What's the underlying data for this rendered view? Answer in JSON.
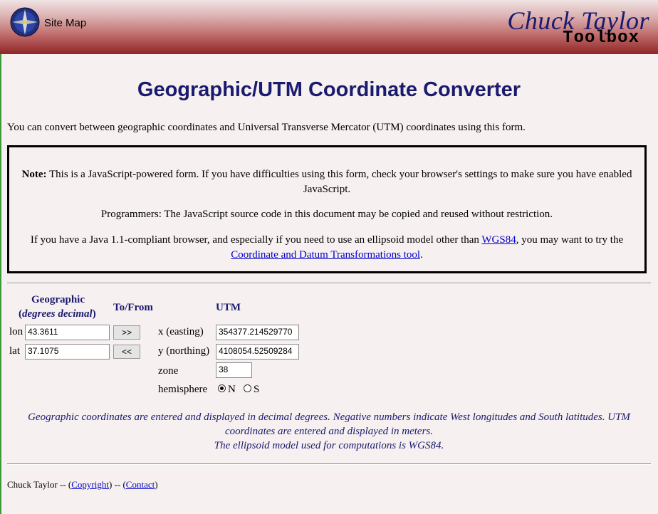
{
  "header": {
    "sitemap_label": "Site Map",
    "brand_line1": "Chuck Taylor",
    "brand_line2": "Toolbox"
  },
  "page_title": "Geographic/UTM Coordinate Converter",
  "intro": "You can convert between geographic coordinates and Universal Transverse Mercator (UTM) coordinates using this form.",
  "notice": {
    "note_label": "Note:",
    "note_text": "This is a JavaScript-powered form. If you have difficulties using this form, check your browser's settings to make sure you have enabled JavaScript.",
    "programmers": "Programmers: The JavaScript source code in this document may be copied and reused without restriction.",
    "java_pre": "If you have a Java 1.1-compliant browser, and especially if you need to use an ellipsoid model other than ",
    "wgs84": "WGS84",
    "java_mid": ", you may want to try the ",
    "tool_link": "Coordinate and Datum Transformations tool",
    "java_end": "."
  },
  "form": {
    "geographic_heading": "Geographic",
    "geographic_units": "degrees decimal",
    "tofrom_heading": "To/From",
    "utm_heading": "UTM",
    "lon_label": "lon",
    "lon_value": "43.3611",
    "lat_label": "lat",
    "lat_value": "37.1075",
    "to_utm_btn": ">>",
    "to_geo_btn": "<<",
    "easting_label": "x (easting)",
    "easting_value": "354377.214529770",
    "northing_label": "y (northing)",
    "northing_value": "4108054.52509284",
    "zone_label": "zone",
    "zone_value": "38",
    "hemisphere_label": "hemisphere",
    "hemi_north": "N",
    "hemi_south": "S",
    "hemi_selected": "N"
  },
  "geo_note": {
    "line1": "Geographic coordinates are entered and displayed in decimal degrees. Negative numbers indicate West longitudes and South latitudes. UTM coordinates are entered and displayed in meters.",
    "line2": "The ellipsoid model used for computations is WGS84."
  },
  "footer": {
    "author": "Chuck Taylor --",
    "copyright_link": "Copyright",
    "sep": "--",
    "contact_link": "Contact"
  },
  "colors": {
    "title": "#1a1a6e",
    "header_bottom": "#8f2525",
    "link": "#0000cc"
  }
}
